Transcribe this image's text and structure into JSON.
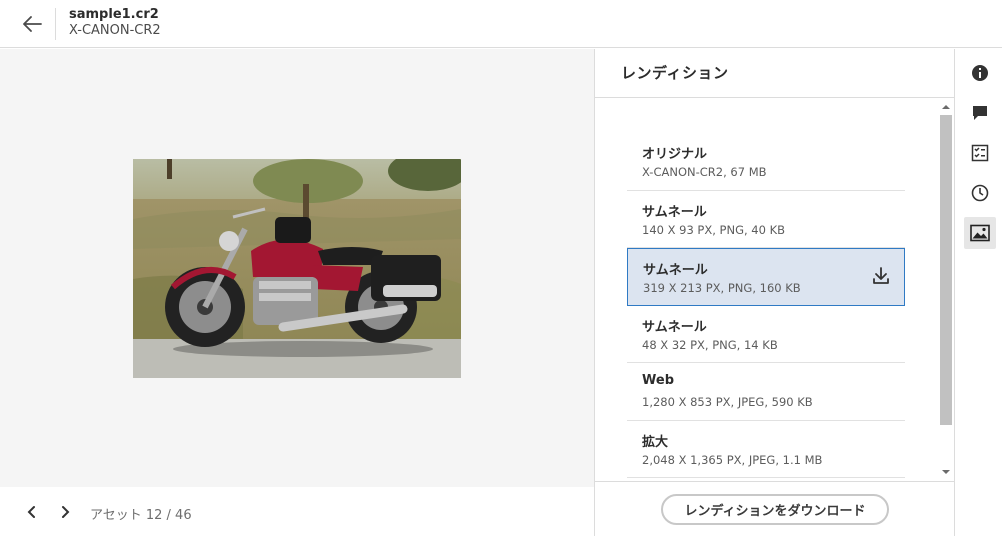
{
  "header": {
    "file_name": "sample1.cr2",
    "file_type": "X-CANON-CR2",
    "back_icon": "arrow-left-icon"
  },
  "preview": {
    "image_subject": "red-motorcycle-photo"
  },
  "navigation": {
    "prev_icon": "chevron-left-icon",
    "next_icon": "chevron-right-icon",
    "counter": "アセット 12 / 46"
  },
  "panel": {
    "title": "レンディション",
    "renditions": [
      {
        "name": "オリジナル",
        "meta": "X-CANON-CR2, 67 MB",
        "selected": false
      },
      {
        "name": "サムネール",
        "meta": "140 X 93 PX, PNG, 40 KB",
        "selected": false
      },
      {
        "name": "サムネール",
        "meta": "319 X 213 PX, PNG, 160 KB",
        "selected": true
      },
      {
        "name": "サムネール",
        "meta": "48 X 32 PX, PNG, 14 KB",
        "selected": false
      },
      {
        "name": "Web",
        "meta": "1,280 X 853 PX, JPEG, 590 KB",
        "selected": false
      },
      {
        "name": "拡大",
        "meta": "2,048 X 1,365 PX, JPEG, 1.1 MB",
        "selected": false
      }
    ],
    "download_button": "レンディションをダウンロード",
    "download_icon": "download-icon"
  },
  "rail": {
    "items": [
      {
        "icon": "info-icon",
        "active": false
      },
      {
        "icon": "comment-icon",
        "active": false
      },
      {
        "icon": "checklist-icon",
        "active": false
      },
      {
        "icon": "clock-icon",
        "active": false
      },
      {
        "icon": "image-icon",
        "active": true
      }
    ]
  },
  "colors": {
    "selected_bg": "#dce4f0",
    "selected_border": "#2f7ac4",
    "preview_bg": "#f5f5f5"
  }
}
